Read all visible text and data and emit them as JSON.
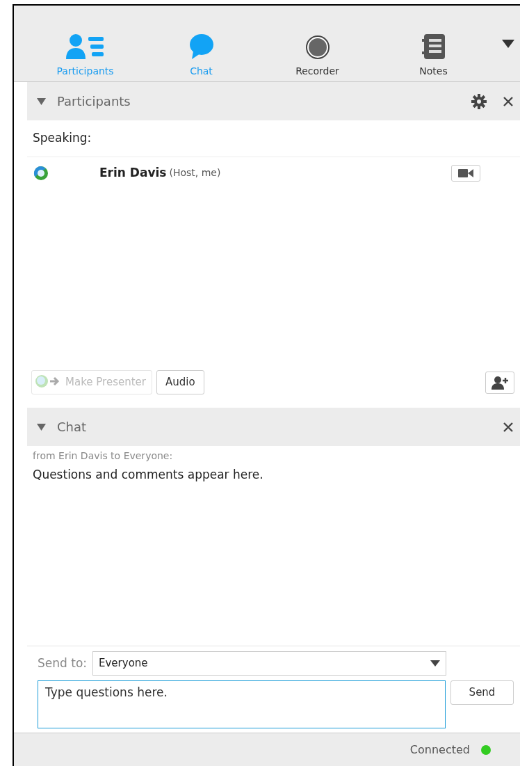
{
  "tabs": [
    {
      "label": "Participants",
      "kind": "participants",
      "selected": true
    },
    {
      "label": "Chat",
      "kind": "chat",
      "selected": true
    },
    {
      "label": "Recorder",
      "kind": "recorder",
      "selected": false
    },
    {
      "label": "Notes",
      "kind": "notes",
      "selected": false
    }
  ],
  "participants_panel": {
    "title": "Participants",
    "expanded": true,
    "speaking_label": "Speaking:",
    "participants": [
      {
        "name": "Erin Davis",
        "role": "(Host, me)"
      }
    ],
    "buttons": [
      {
        "label": "Make Presenter",
        "kind": "presenter",
        "disabled": true
      },
      {
        "label": "Audio",
        "kind": "plain",
        "disabled": false
      }
    ]
  },
  "chat_panel": {
    "title": "Chat",
    "expanded": true,
    "messages": [
      {
        "header": "from Erin Davis to Everyone:",
        "text": "Questions and comments appear here."
      }
    ],
    "send_to_label": "Send to:",
    "send_to_value": "Everyone",
    "placeholder": "Type questions here.",
    "send_button": "Send"
  },
  "status_bar": {
    "text": "Connected",
    "color": "#33cc22"
  }
}
